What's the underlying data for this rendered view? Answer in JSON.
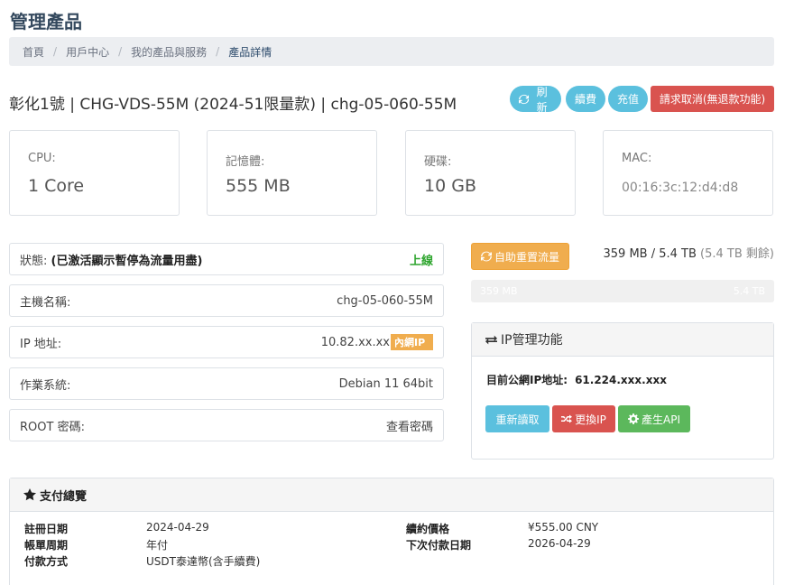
{
  "page": {
    "title": "管理產品"
  },
  "breadcrumb": {
    "items": [
      "首頁",
      "用戶中心",
      "我的產品與服務"
    ],
    "active": "產品詳情"
  },
  "product": {
    "title": "彰化1號 | CHG-VDS-55M (2024-51限量款) | chg-05-060-55M"
  },
  "actions": {
    "refresh": "刷新",
    "renew": "續費",
    "topup": "充值",
    "cancel": "請求取消(無退款功能)"
  },
  "stats": [
    {
      "label": "CPU:",
      "value": "1 Core"
    },
    {
      "label": "記憶體:",
      "value": "555 MB"
    },
    {
      "label": "硬碟:",
      "value": "10 GB"
    },
    {
      "label": "MAC:",
      "value": "00:16:3c:12:d4:d8"
    }
  ],
  "details": {
    "status_label": "狀態:",
    "status_note": "(已激活顯示暫停為流量用盡)",
    "status_value": "上線",
    "hostname_label": "主機名稱:",
    "hostname_value": "chg-05-060-55M",
    "ip_label": "IP 地址:",
    "ip_value": "10.82.xx.xx",
    "ip_badge": "內網IP",
    "os_label": "作業系統:",
    "os_value": "Debian 11 64bit",
    "root_label": "ROOT 密碼:",
    "root_value": "查看密碼"
  },
  "traffic": {
    "reset_label": "自助重置流量",
    "summary": "359 MB / 5.4 TB",
    "remaining": "(5.4 TB 剩餘)",
    "used_label": "359 MB",
    "total_label": "5.4 TB",
    "used_fraction": 0.0001
  },
  "ip_panel": {
    "title": "IP管理功能",
    "current_label": "目前公網IP地址:",
    "current_value": "61.224.xxx.xxx",
    "reload": "重新讀取",
    "change": "更換IP",
    "api": "產生API"
  },
  "payment": {
    "title": "支付總覽",
    "reg_label": "註冊日期",
    "reg_value": "2024-04-29",
    "cycle_label": "帳單周期",
    "cycle_value": "年付",
    "method_label": "付款方式",
    "method_value": "USDT泰達幣(含手續費)",
    "price_label": "續約價格",
    "price_value": "¥555.00 CNY",
    "next_label": "下次付款日期",
    "next_value": "2026-04-29"
  },
  "colors": {
    "info": "#5bc0de",
    "danger": "#d9534f",
    "warning": "#f0ad4e",
    "success": "#5cb85c",
    "online": "#2ea52e"
  }
}
